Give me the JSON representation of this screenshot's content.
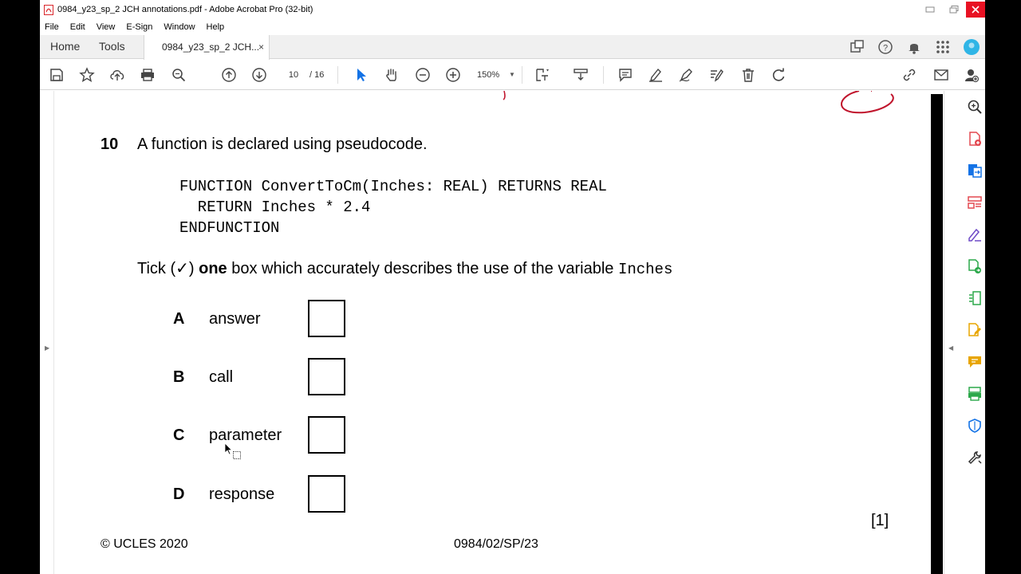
{
  "window": {
    "title": "0984_y23_sp_2 JCH annotations.pdf - Adobe Acrobat Pro (32-bit)"
  },
  "menu": [
    "File",
    "Edit",
    "View",
    "E-Sign",
    "Window",
    "Help"
  ],
  "tabs": {
    "home": "Home",
    "tools": "Tools",
    "document": "0984_y23_sp_2 JCH...",
    "close_glyph": "×"
  },
  "toolbar": {
    "page_current": "10",
    "page_total": "/ 16",
    "zoom": "150%"
  },
  "document": {
    "question_number": "10",
    "question_text": "A function is declared using pseudocode.",
    "code_lines": [
      "FUNCTION ConvertToCm(Inches: REAL) RETURNS REAL",
      "  RETURN Inches * 2.4",
      "ENDFUNCTION"
    ],
    "instruction_pre": "Tick (✓) ",
    "instruction_bold": "one",
    "instruction_post": " box which accurately describes the use of the variable ",
    "instruction_var": "Inches",
    "options": [
      {
        "letter": "A",
        "text": "answer"
      },
      {
        "letter": "B",
        "text": "call"
      },
      {
        "letter": "C",
        "text": "parameter"
      },
      {
        "letter": "D",
        "text": "response"
      }
    ],
    "marks": "[1]",
    "footer_left": "© UCLES 2020",
    "footer_center": "0984/02/SP/23"
  },
  "colors": {
    "annotation": "#c0142c",
    "acrobat_red": "#d9262b",
    "accent_blue": "#1473e6",
    "right_panel_icons": [
      "#e34850",
      "#1473e6",
      "#e34850",
      "#6e4ac7",
      "#2ba84a",
      "#2ba84a",
      "#e8a500",
      "#e8a500",
      "#2ba84a",
      "#1473e6",
      "#333333"
    ]
  }
}
